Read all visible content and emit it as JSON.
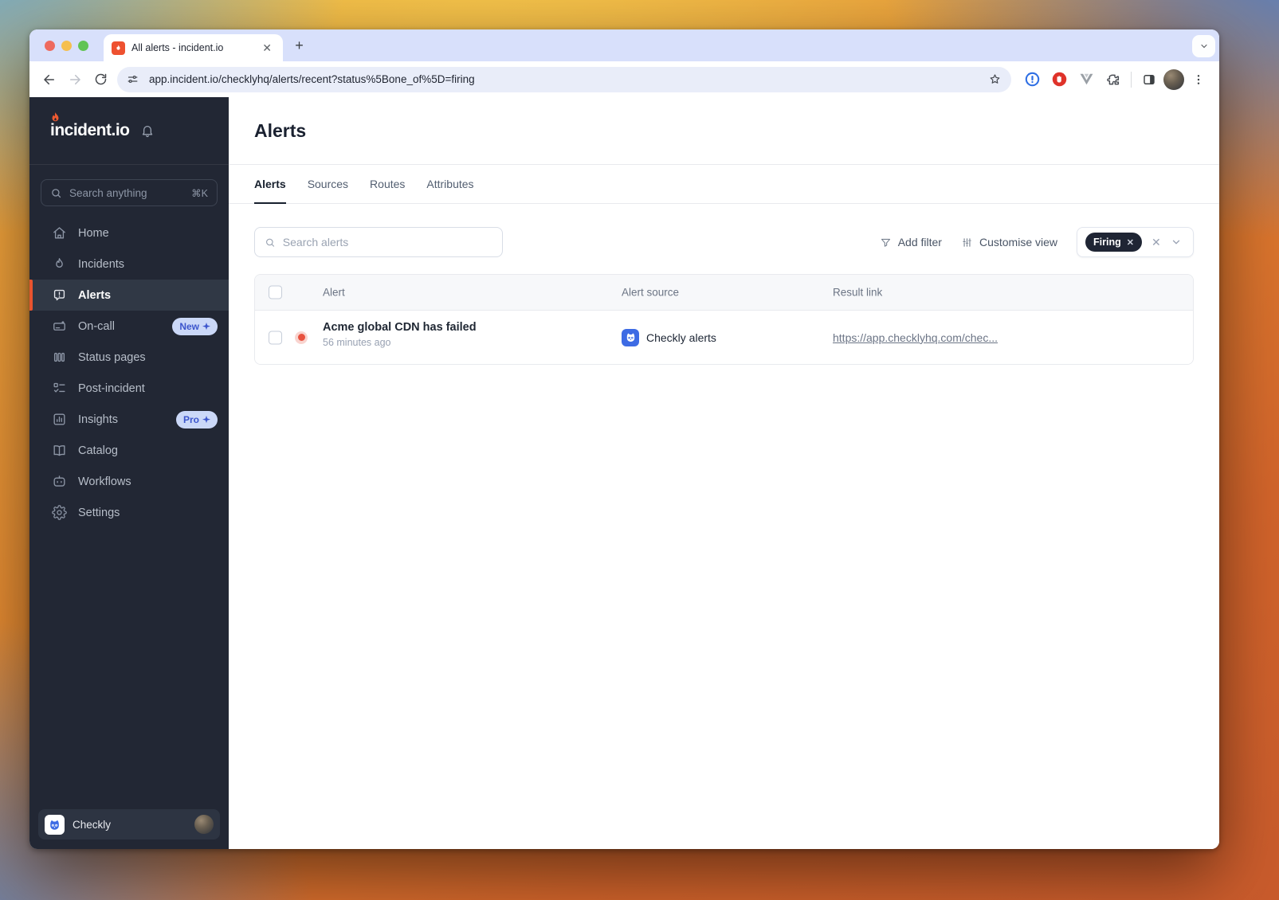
{
  "browser": {
    "tab_title": "All alerts - incident.io",
    "url": "app.incident.io/checklyhq/alerts/recent?status%5Bone_of%5D=firing",
    "toolbar_icons": [
      "back-icon",
      "forward-icon",
      "reload-icon",
      "site-info-icon",
      "bookmark-star-icon",
      "onepassword-icon",
      "adblock-icon",
      "vue-devtools-icon",
      "extensions-icon",
      "side-panel-icon",
      "profile-avatar",
      "menu-icon"
    ]
  },
  "sidebar": {
    "brand": "incident.io",
    "search_placeholder": "Search anything",
    "search_shortcut": "⌘K",
    "items": [
      {
        "label": "Home",
        "icon": "home-icon"
      },
      {
        "label": "Incidents",
        "icon": "flame-icon"
      },
      {
        "label": "Alerts",
        "icon": "alert-bubble-icon",
        "active": true
      },
      {
        "label": "On-call",
        "icon": "pager-icon",
        "badge": "New"
      },
      {
        "label": "Status pages",
        "icon": "status-bars-icon"
      },
      {
        "label": "Post-incident",
        "icon": "checklist-icon"
      },
      {
        "label": "Insights",
        "icon": "bar-chart-icon",
        "badge": "Pro"
      },
      {
        "label": "Catalog",
        "icon": "book-icon"
      },
      {
        "label": "Workflows",
        "icon": "robot-icon"
      },
      {
        "label": "Settings",
        "icon": "gear-icon"
      }
    ],
    "workspace": "Checkly"
  },
  "main": {
    "title": "Alerts",
    "tabs": [
      {
        "label": "Alerts",
        "active": true
      },
      {
        "label": "Sources"
      },
      {
        "label": "Routes"
      },
      {
        "label": "Attributes"
      }
    ],
    "search_placeholder": "Search alerts",
    "toolbar": {
      "add_filter": "Add filter",
      "customise_view": "Customise view",
      "filter_chip": "Firing"
    },
    "table": {
      "columns": [
        "Alert",
        "Alert source",
        "Result link"
      ],
      "rows": [
        {
          "title": "Acme global CDN has failed",
          "time": "56 minutes ago",
          "source": "Checkly alerts",
          "link": "https://app.checklyhq.com/chec..."
        }
      ]
    }
  },
  "colors": {
    "accent_orange": "#e8542e",
    "sidebar_bg": "#222734",
    "firing_chip_bg": "#1f2534",
    "alert_dot": "#e8523f",
    "checkly_blue": "#3d6be4",
    "badge_bg": "#cbd8f8",
    "badge_text": "#3c55cc",
    "tabstrip_bg": "#d8e0fb"
  }
}
